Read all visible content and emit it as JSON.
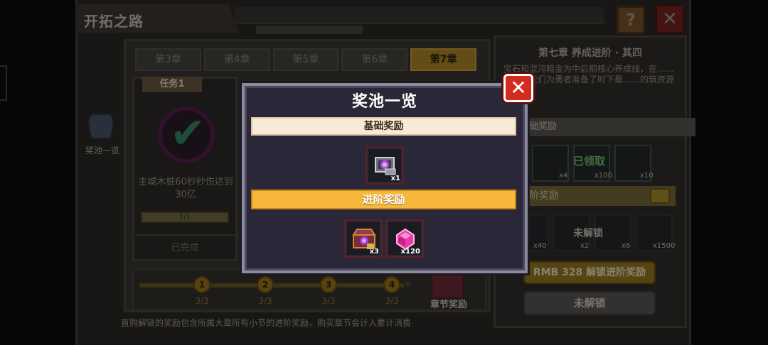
{
  "window": {
    "title": "开拓之路",
    "help_label": "?",
    "close_label": "✕"
  },
  "chapter_tabs": [
    "第3章",
    "第4章",
    "第5章",
    "第6章",
    "第7章"
  ],
  "active_tab_index": 4,
  "task": {
    "label": "任务1",
    "description": "主城木桩60秒秒伤达到30亿",
    "progress": "1/1",
    "status": "已完成"
  },
  "side_pool": {
    "label": "奖池一览",
    "icon": "reward-pool-icon"
  },
  "milestones": [
    {
      "num": "1",
      "count": "3/3"
    },
    {
      "num": "2",
      "count": "3/3"
    },
    {
      "num": "3",
      "count": "3/3"
    },
    {
      "num": "4",
      "count": "3/3"
    }
  ],
  "chapter_reward_label": "章节奖励",
  "footer_note": "直购解锁的奖励包含所属大章所有小节的进阶奖励，购买章节会计入累计消费",
  "right_panel": {
    "title": "第七章 养成进阶 · 其四",
    "description": "宝石和混沌暗金为中后期核心养成线，在……的末尾我们为勇者准备了时下最……的筑资源",
    "basic_header": "础奖励",
    "basic_counts": [
      "x4",
      "x100",
      "x10"
    ],
    "claimed_label": "已领取",
    "adv_header": "阶奖励",
    "adv_counts": [
      "x40",
      "x2",
      "x6",
      "x1500"
    ],
    "adv_unlock_label": "未解锁",
    "buy_label": "RMB 328 解锁进阶奖励",
    "locked_label": "未解锁"
  },
  "modal": {
    "title": "奖池一览",
    "close_label": "✕",
    "basic_section": {
      "title": "基础奖励",
      "items": [
        {
          "icon": "purple-chest-icon",
          "count": "x1"
        }
      ]
    },
    "advanced_section": {
      "title": "进阶奖励",
      "items": [
        {
          "icon": "treasure-chest-icon",
          "count": "x3"
        },
        {
          "icon": "pink-gem-icon",
          "count": "x120"
        }
      ]
    }
  },
  "colors": {
    "basic_header_bg": "#f7ebd5",
    "advanced_header_bg": "#f6b73b",
    "close_button": "#d42b1f",
    "gem_pink": "#e83aa8"
  }
}
